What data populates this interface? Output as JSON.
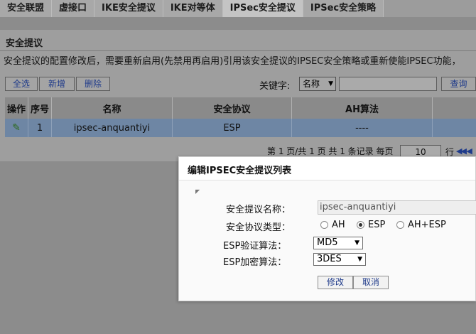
{
  "tabs": [
    {
      "label": "安全联盟",
      "active": false
    },
    {
      "label": "虚接口",
      "active": false
    },
    {
      "label": "IKE安全提议",
      "active": false
    },
    {
      "label": "IKE对等体",
      "active": false
    },
    {
      "label": "IPSec安全提议",
      "active": true
    },
    {
      "label": "IPSec安全策略",
      "active": false
    }
  ],
  "panel": {
    "title": "安全提议",
    "notice": "安全提议的配置修改后，需要重新启用(先禁用再启用)引用该安全提议的IPSEC安全策略或重新使能IPSEC功能，"
  },
  "toolbar": {
    "select_all": "全选",
    "add": "新增",
    "delete": "删除",
    "keyword_label": "关键字:",
    "keyword_field": "名称",
    "keyword_value": "",
    "search": "查询"
  },
  "table": {
    "headers": [
      "操作",
      "序号",
      "名称",
      "安全协议",
      "AH算法"
    ],
    "rows": [
      {
        "action_icon": "pencil-icon",
        "index": "1",
        "name": "ipsec-anquantiyi",
        "protocol": "ESP",
        "ah_algo": "----"
      }
    ]
  },
  "pager": {
    "text": "第 1 页/共 1 页 共 1 条记录 每页",
    "page_size": "10",
    "suffix": "行"
  },
  "dialog": {
    "title": "编辑IPSEC安全提议列表",
    "name_label": "安全提议名称：",
    "name_value": "ipsec-anquantiyi",
    "protocol_label": "安全协议类型：",
    "protocol_options": [
      "AH",
      "ESP",
      "AH+ESP"
    ],
    "protocol_selected": "ESP",
    "esp_auth_label": "ESP验证算法：",
    "esp_auth_value": "MD5",
    "esp_enc_label": "ESP加密算法：",
    "esp_enc_value": "3DES",
    "modify": "修改",
    "cancel": "取消"
  }
}
